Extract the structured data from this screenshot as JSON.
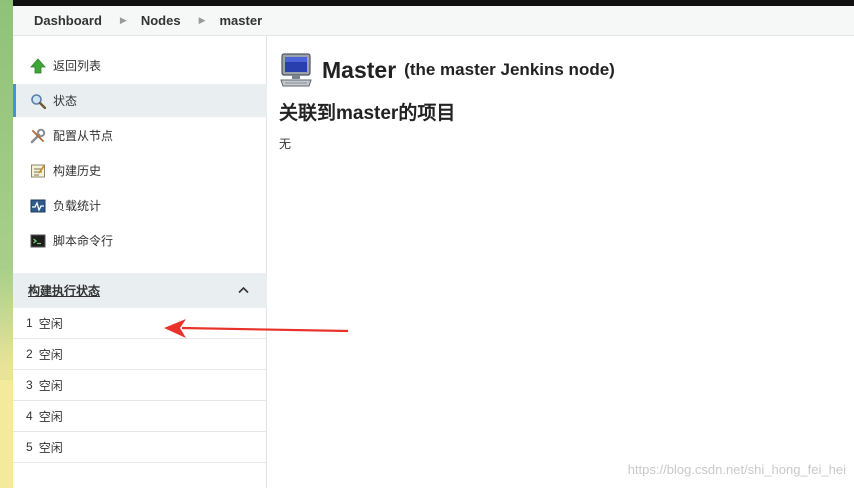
{
  "breadcrumb": {
    "items": [
      "Dashboard",
      "Nodes",
      "master"
    ]
  },
  "sidebar": {
    "tasks": [
      {
        "label": "返回列表",
        "icon": "up-arrow-icon"
      },
      {
        "label": "状态",
        "icon": "search-icon"
      },
      {
        "label": "配置从节点",
        "icon": "wrench-icon"
      },
      {
        "label": "构建历史",
        "icon": "notepad-icon"
      },
      {
        "label": "负载统计",
        "icon": "chart-icon"
      },
      {
        "label": "脚本命令行",
        "icon": "terminal-icon"
      }
    ],
    "executors": {
      "title": "构建执行状态",
      "collapse_icon": "chevron-up-icon",
      "rows": [
        {
          "number": "1",
          "status": "空闲"
        },
        {
          "number": "2",
          "status": "空闲"
        },
        {
          "number": "3",
          "status": "空闲"
        },
        {
          "number": "4",
          "status": "空闲"
        },
        {
          "number": "5",
          "status": "空闲"
        }
      ]
    }
  },
  "main": {
    "title": "Master",
    "subtitle": "(the master Jenkins node)",
    "projects_heading": "关联到master的项目",
    "projects_empty": "无"
  },
  "watermark": "https://blog.csdn.net/shi_hong_fei_hei",
  "colors": {
    "accent": "#4a90d9",
    "arrow": "#e8322a",
    "panel": "#e9eef0"
  }
}
